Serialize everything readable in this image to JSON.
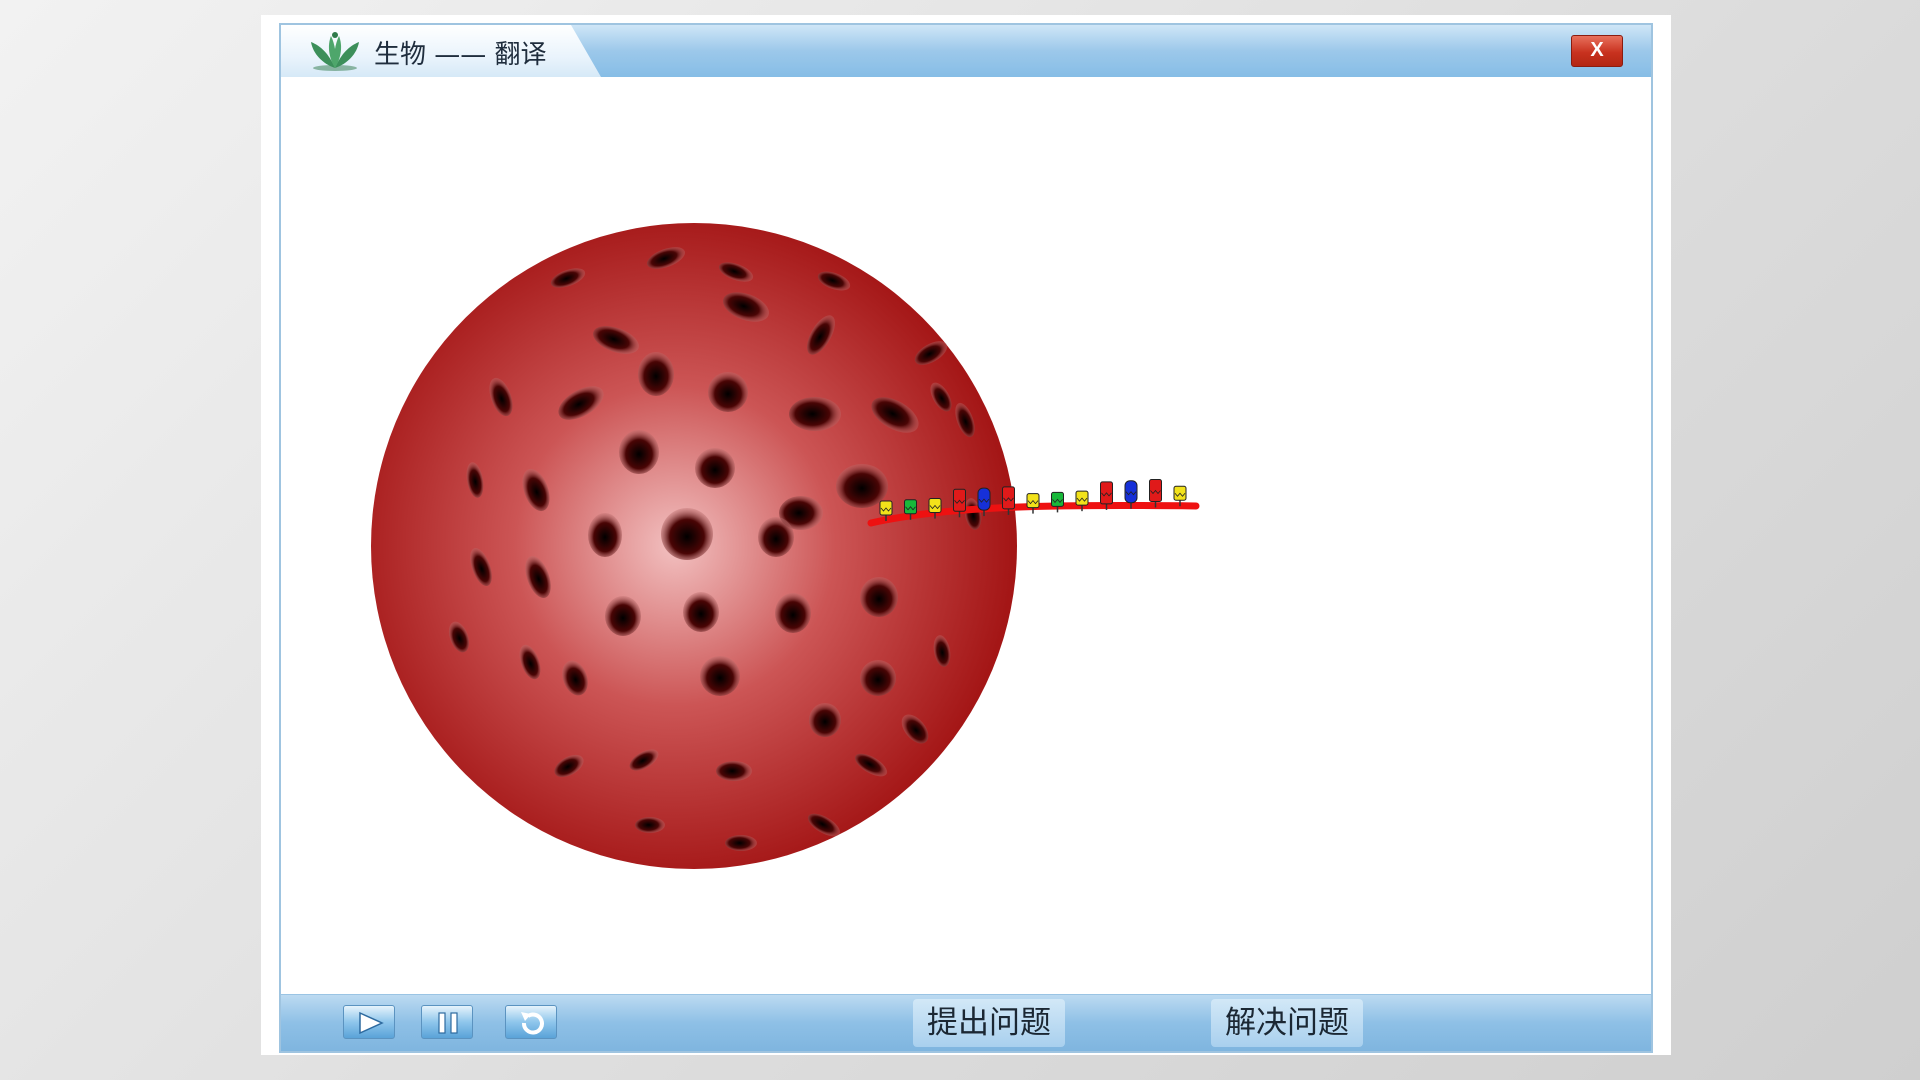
{
  "window": {
    "title": "生物 —— 翻译",
    "close_label": "X"
  },
  "controls": {
    "play": "play-icon",
    "pause": "pause-icon",
    "replay": "replay-icon",
    "raise_question_label": "提出问题",
    "solve_question_label": "解决问题"
  },
  "colors": {
    "ribosome": "#a81515",
    "mrna": "#ee1111",
    "titlebar": "#8fc2e9",
    "close": "#c8321f",
    "nucleotide_yellow": "#f2e21a",
    "nucleotide_green": "#18b83a",
    "nucleotide_red": "#e01a1a",
    "nucleotide_blue": "#1630d8"
  },
  "mrna_bases": [
    "yellow",
    "green",
    "yellow",
    "red",
    "blue",
    "red",
    "yellow",
    "green",
    "yellow",
    "red",
    "blue",
    "red",
    "yellow"
  ]
}
